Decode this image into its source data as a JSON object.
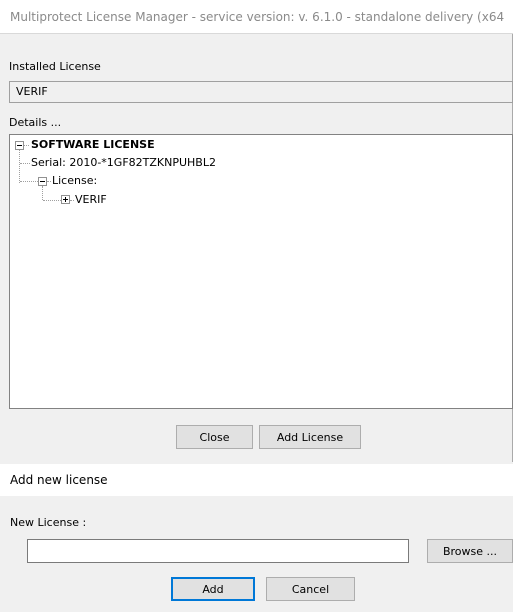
{
  "main_dialog": {
    "title": "Multiprotect License Manager - service version: v. 6.1.0 - standalone delivery (x64",
    "installed_label": "Installed License",
    "installed_value": "VERIF",
    "details_label": "Details ...",
    "tree": {
      "root": "SOFTWARE LICENSE",
      "serial": "Serial: 2010-*1GF82TZKNPUHBL2",
      "license_node": "License:",
      "license_child": "VERIF"
    },
    "buttons": {
      "close": "Close",
      "add_license": "Add License"
    }
  },
  "add_dialog": {
    "title": "Add new license",
    "new_license_label": "New License :",
    "new_license_value": "",
    "buttons": {
      "browse": "Browse ...",
      "add": "Add",
      "cancel": "Cancel"
    }
  }
}
